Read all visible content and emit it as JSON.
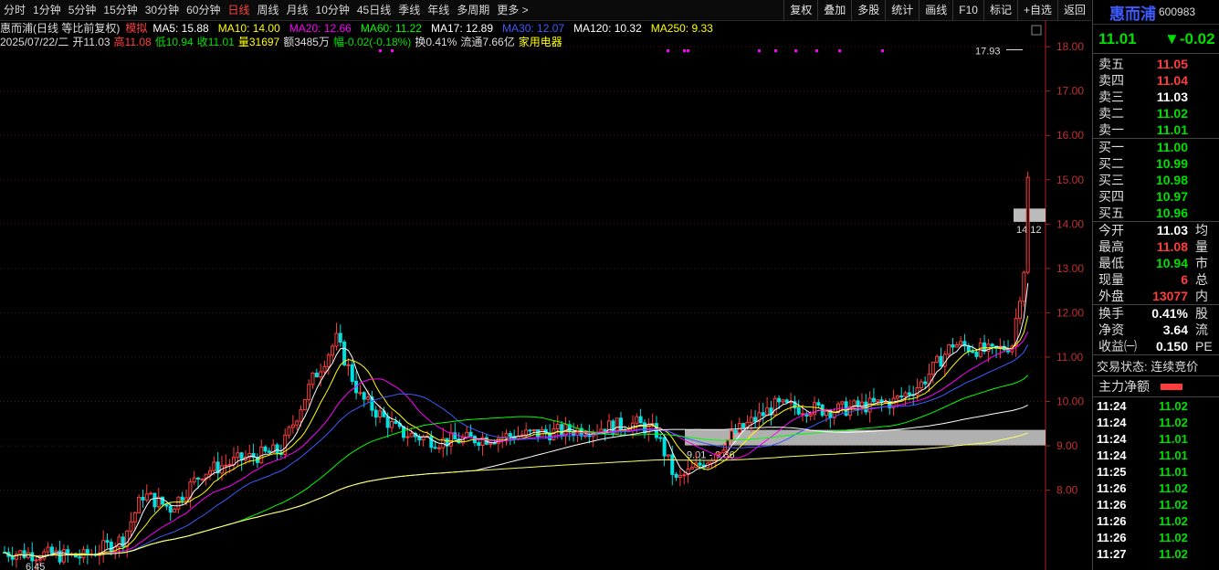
{
  "periods": [
    "分时",
    "1分钟",
    "5分钟",
    "15分钟",
    "30分钟",
    "60分钟",
    "日线",
    "周线",
    "月线",
    "10分钟",
    "45日线",
    "季线",
    "年线",
    "多周期",
    "更多 >"
  ],
  "active_period": "日线",
  "tools": [
    "复权",
    "叠加",
    "多股",
    "统计",
    "画线",
    "F10",
    "标记",
    "+自选",
    "返回"
  ],
  "ma_bar": {
    "title": "惠而浦(日线 等比前复权)",
    "mode": "模拟",
    "items": [
      {
        "label": "MA5: 15.88",
        "color": "#ffffff"
      },
      {
        "label": "MA10: 14.00",
        "color": "#ffff00"
      },
      {
        "label": "MA20: 12.66",
        "color": "#ff00ff"
      },
      {
        "label": "MA60: 11.22",
        "color": "#00ff00"
      },
      {
        "label": "MA17: 12.89",
        "color": "#ffffff"
      },
      {
        "label": "MA30: 12.07",
        "color": "#3d5bff"
      },
      {
        "label": "MA120: 10.32",
        "color": "#ffffff"
      },
      {
        "label": "MA250: 9.33",
        "color": "#ffff00"
      }
    ]
  },
  "info_bar": {
    "date": "2025/07/22/二",
    "open": "开11.03",
    "high": "高11.08",
    "low": "低10.94",
    "close": "收11.01",
    "volume": "量31697",
    "amount": "额3485万",
    "change": "幅-0.02(-0.18%)",
    "turnover": "换0.41%",
    "float_cap": "流通7.66亿",
    "industry": "家用电器"
  },
  "axis": {
    "ticks": [
      "18.00",
      "17.00",
      "16.00",
      "15.00",
      "14.00",
      "13.00",
      "12.00",
      "11.00",
      "10.00",
      "9.00",
      "8.00"
    ],
    "min_price": 6.2,
    "max_price": 18.2
  },
  "annotations": {
    "high_label": "17.93",
    "low_label": "6.45",
    "zone1_label": "9.01 - 9.36",
    "zone2_label": "14.12"
  },
  "stock": {
    "name": "惠而浦",
    "code": "600983",
    "price": "11.01",
    "change": "▼-0.02"
  },
  "asks": [
    {
      "label": "卖五",
      "price": "11.05"
    },
    {
      "label": "卖四",
      "price": "11.04"
    },
    {
      "label": "卖三",
      "price": "11.03"
    },
    {
      "label": "卖二",
      "price": "11.02"
    },
    {
      "label": "卖一",
      "price": "11.01"
    }
  ],
  "bids": [
    {
      "label": "买一",
      "price": "11.00"
    },
    {
      "label": "买二",
      "price": "10.99"
    },
    {
      "label": "买三",
      "price": "10.98"
    },
    {
      "label": "买四",
      "price": "10.97"
    },
    {
      "label": "买五",
      "price": "10.96"
    }
  ],
  "stats": [
    {
      "label": "今开",
      "value": "11.03",
      "aux": "均"
    },
    {
      "label": "最高",
      "value": "11.08",
      "aux": "量"
    },
    {
      "label": "最低",
      "value": "10.94",
      "aux": "市"
    },
    {
      "label": "现量",
      "value": "6",
      "aux": "总"
    },
    {
      "label": "外盘",
      "value": "13077",
      "aux": "内"
    }
  ],
  "stats2": [
    {
      "label": "换手",
      "value": "0.41%",
      "aux": "股"
    },
    {
      "label": "净资",
      "value": "3.64",
      "aux": "流"
    },
    {
      "label": "收益㈠",
      "value": "0.150",
      "aux": "PE"
    }
  ],
  "trade_status": "交易状态: 连续竞价",
  "main_flow": "主力净额",
  "ticks": [
    {
      "time": "11:24",
      "price": "11.02"
    },
    {
      "time": "11:24",
      "price": "11.02"
    },
    {
      "time": "11:24",
      "price": "11.01"
    },
    {
      "time": "11:24",
      "price": "11.01"
    },
    {
      "time": "11:25",
      "price": "11.01"
    },
    {
      "time": "11:26",
      "price": "11.02"
    },
    {
      "time": "11:26",
      "price": "11.02"
    },
    {
      "time": "11:26",
      "price": "11.02"
    },
    {
      "time": "11:26",
      "price": "11.02"
    },
    {
      "time": "11:27",
      "price": "11.02"
    }
  ]
}
